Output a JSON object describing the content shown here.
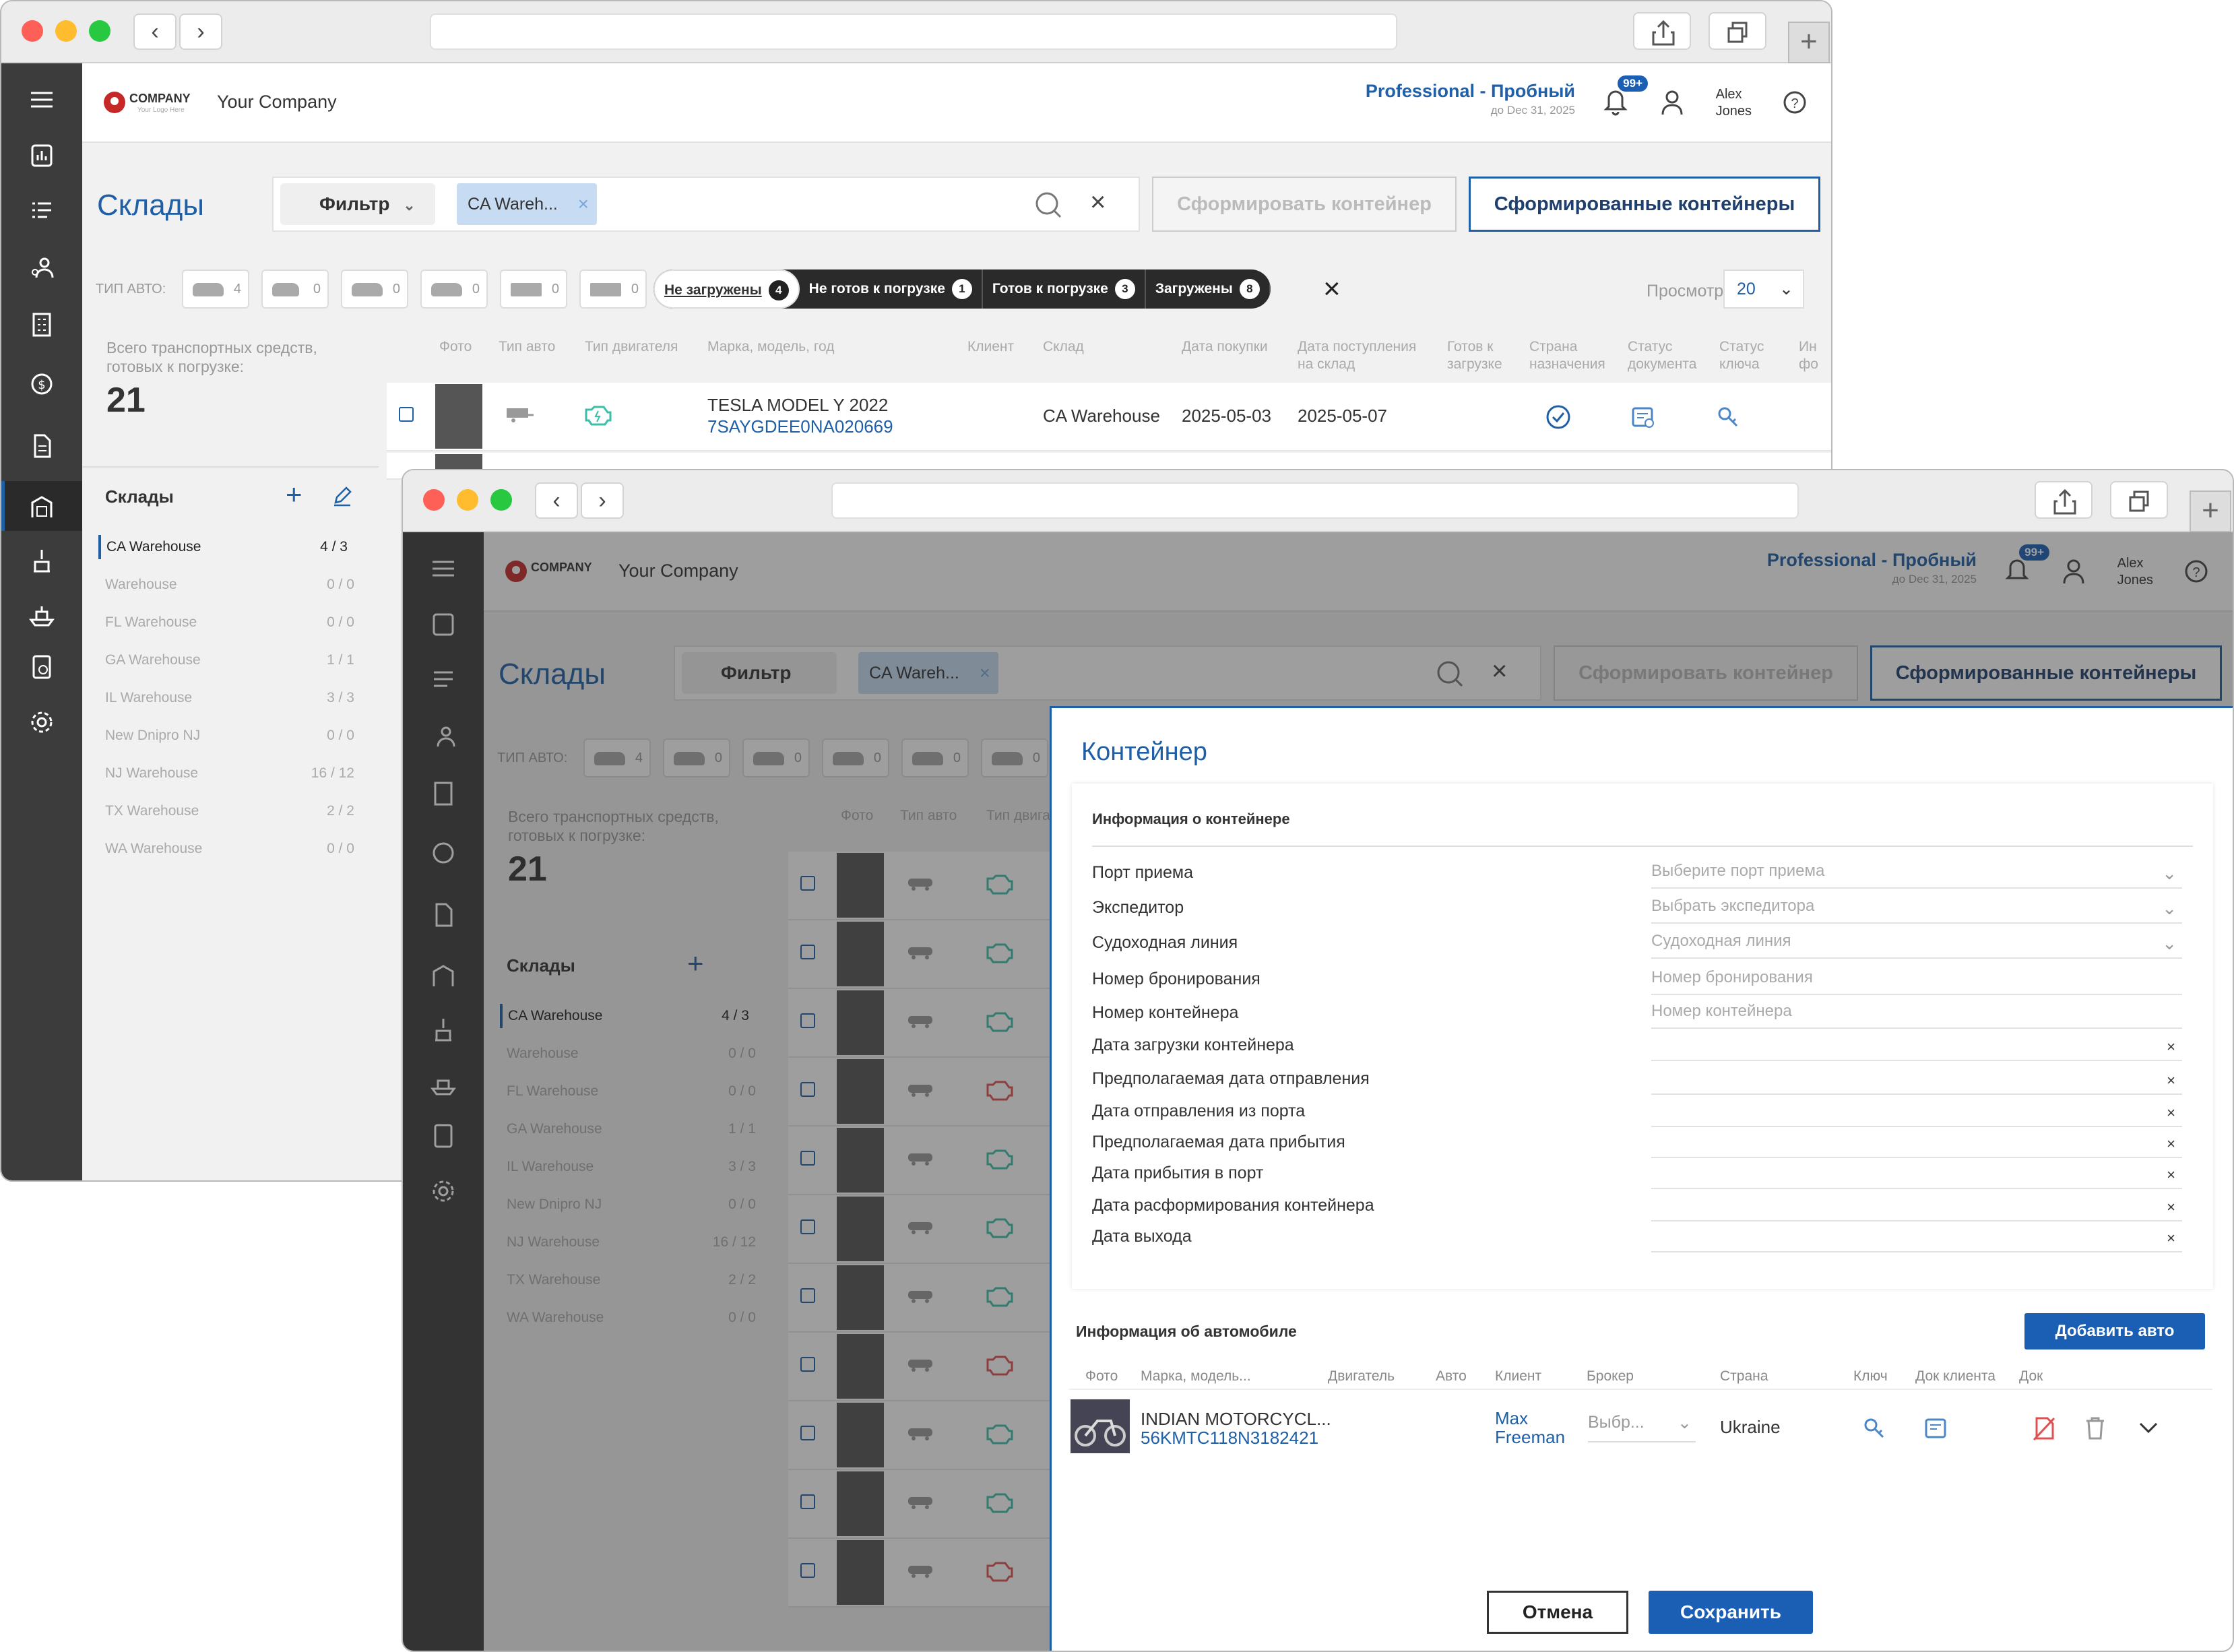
{
  "window1": {
    "header": {
      "company": "Your Company",
      "plan": "Professional - Пробный",
      "plan_until": "до Dec 31, 2025",
      "notif_badge": "99+",
      "user_line1": "Alex",
      "user_line2": "Jones"
    },
    "page_title": "Склады",
    "filter_label": "Фильтр",
    "filter_chip": "CA Wareh...",
    "btn_form": "Сформировать контейнер",
    "btn_formed": "Сформированные контейнеры",
    "type_label": "ТИП АВТО:",
    "types": [
      "4",
      "0",
      "0",
      "0",
      "0",
      "0"
    ],
    "segments": [
      {
        "label": "Не загружены",
        "count": "4"
      },
      {
        "label": "Не готов к погрузке",
        "count": "1"
      },
      {
        "label": "Готов к погрузке",
        "count": "3"
      },
      {
        "label": "Загружены",
        "count": "8"
      }
    ],
    "view_label": "Просмотр",
    "view_value": "20",
    "summary_label": "Всего транспортных средств, готовых к погрузке:",
    "summary_count": "21",
    "warehouses_title": "Склады",
    "warehouses": [
      {
        "name": "CA Warehouse",
        "count": "4 / 3"
      },
      {
        "name": "Warehouse",
        "count": "0 / 0"
      },
      {
        "name": "FL Warehouse",
        "count": "0 / 0"
      },
      {
        "name": "GA Warehouse",
        "count": "1 / 1"
      },
      {
        "name": "IL Warehouse",
        "count": "3 / 3"
      },
      {
        "name": "New Dnipro NJ",
        "count": "0 / 0"
      },
      {
        "name": "NJ Warehouse",
        "count": "16 / 12"
      },
      {
        "name": "TX Warehouse",
        "count": "2 / 2"
      },
      {
        "name": "WA Warehouse",
        "count": "0 / 0"
      }
    ],
    "columns": [
      "Фото",
      "Тип авто",
      "Тип двигателя",
      "Марка, модель, год",
      "Клиент",
      "Склад",
      "Дата покупки",
      "Дата поступления на склад",
      "Готов к загрузке",
      "Страна назначения",
      "Статус документа",
      "Статус ключа",
      "Ин фо"
    ],
    "row": {
      "model": "TESLA MODEL Y 2022",
      "vin": "7SAYGDEE0NA020669",
      "warehouse": "CA Warehouse",
      "purchase_date": "2025-05-03",
      "arrival_date": "2025-05-07"
    }
  },
  "dialog": {
    "title": "Контейнер",
    "info_title": "Информация о контейнере",
    "fields": [
      {
        "label": "Порт приема",
        "value": "Выберите порт приема",
        "type": "select"
      },
      {
        "label": "Экспедитор",
        "value": "Выбрать экспедитора",
        "type": "select"
      },
      {
        "label": "Судоходная линия",
        "value": "Судоходная линия",
        "type": "select"
      },
      {
        "label": "Номер бронирования",
        "value": "Номер бронирования",
        "type": "text"
      },
      {
        "label": "Номер контейнера",
        "value": "Номер контейнера",
        "type": "text"
      },
      {
        "label": "Дата загрузки контейнера",
        "value": "",
        "type": "date"
      },
      {
        "label": "Предполагаемая дата отправления",
        "value": "",
        "type": "date"
      },
      {
        "label": "Дата отправления из порта",
        "value": "",
        "type": "date"
      },
      {
        "label": "Предполагаемая дата прибытия",
        "value": "",
        "type": "date"
      },
      {
        "label": "Дата прибытия в порт",
        "value": "",
        "type": "date"
      },
      {
        "label": "Дата расформирования контейнера",
        "value": "",
        "type": "date"
      },
      {
        "label": "Дата выхода",
        "value": "",
        "type": "date"
      }
    ],
    "vehicle_title": "Информация об автомобиле",
    "add_btn": "Добавить авто",
    "vcols": [
      "Фото",
      "Марка, модель...",
      "Двигатель",
      "Авто",
      "Клиент",
      "Брокер",
      "Страна",
      "Ключ",
      "Док клиента",
      "Док"
    ],
    "vehicle": {
      "model": "INDIAN MOTORCYCL...",
      "vin": "56KMTC118N3182421",
      "client_first": "Max",
      "client_last": "Freeman",
      "broker": "Выбр...",
      "country": "Ukraine"
    },
    "cancel": "Отмена",
    "save": "Сохранить"
  },
  "colors": {
    "accent": "#1f5fa6",
    "rail": "#3c3c3c",
    "button_blue": "#1a5fb4"
  }
}
